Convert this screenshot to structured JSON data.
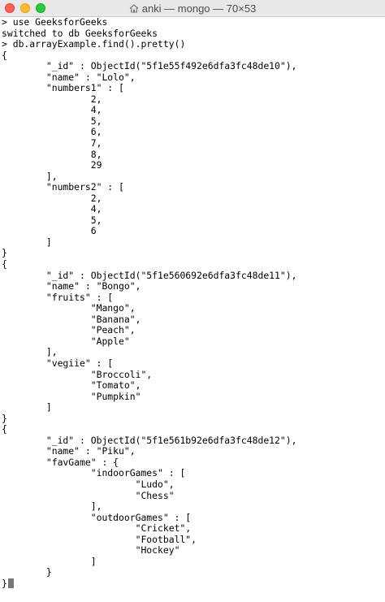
{
  "window": {
    "title": "anki — mongo — 70×53",
    "title_icon": "home-icon"
  },
  "terminal": {
    "lines": [
      "> use GeeksforGeeks",
      "switched to db GeeksforGeeks",
      "> db.arrayExample.find().pretty()",
      "{",
      "        \"_id\" : ObjectId(\"5f1e55f492e6dfa3fc48de10\"),",
      "        \"name\" : \"Lolo\",",
      "        \"numbers1\" : [",
      "                2,",
      "                4,",
      "                5,",
      "                6,",
      "                7,",
      "                8,",
      "                29",
      "        ],",
      "        \"numbers2\" : [",
      "                2,",
      "                4,",
      "                5,",
      "                6",
      "        ]",
      "}",
      "{",
      "        \"_id\" : ObjectId(\"5f1e560692e6dfa3fc48de11\"),",
      "        \"name\" : \"Bongo\",",
      "        \"fruits\" : [",
      "                \"Mango\",",
      "                \"Banana\",",
      "                \"Peach\",",
      "                \"Apple\"",
      "        ],",
      "        \"vegiie\" : [",
      "                \"Broccoli\",",
      "                \"Tomato\",",
      "                \"Pumpkin\"",
      "        ]",
      "}",
      "{",
      "        \"_id\" : ObjectId(\"5f1e561b92e6dfa3fc48de12\"),",
      "        \"name\" : \"Piku\",",
      "        \"favGame\" : {",
      "                \"indoorGames\" : [",
      "                        \"Ludo\",",
      "                        \"Chess\"",
      "                ],",
      "                \"outdoorGames\" : [",
      "                        \"Cricket\",",
      "                        \"Football\",",
      "                        \"Hockey\"",
      "                ]",
      "        }",
      "}",
      "> "
    ]
  },
  "colors": {
    "background": "#ffffff",
    "text": "#000000",
    "titlebar": "#e8e8e8",
    "close": "#ff5f57",
    "minimize": "#febc2e",
    "zoom": "#28c840",
    "cursor": "#777777"
  }
}
